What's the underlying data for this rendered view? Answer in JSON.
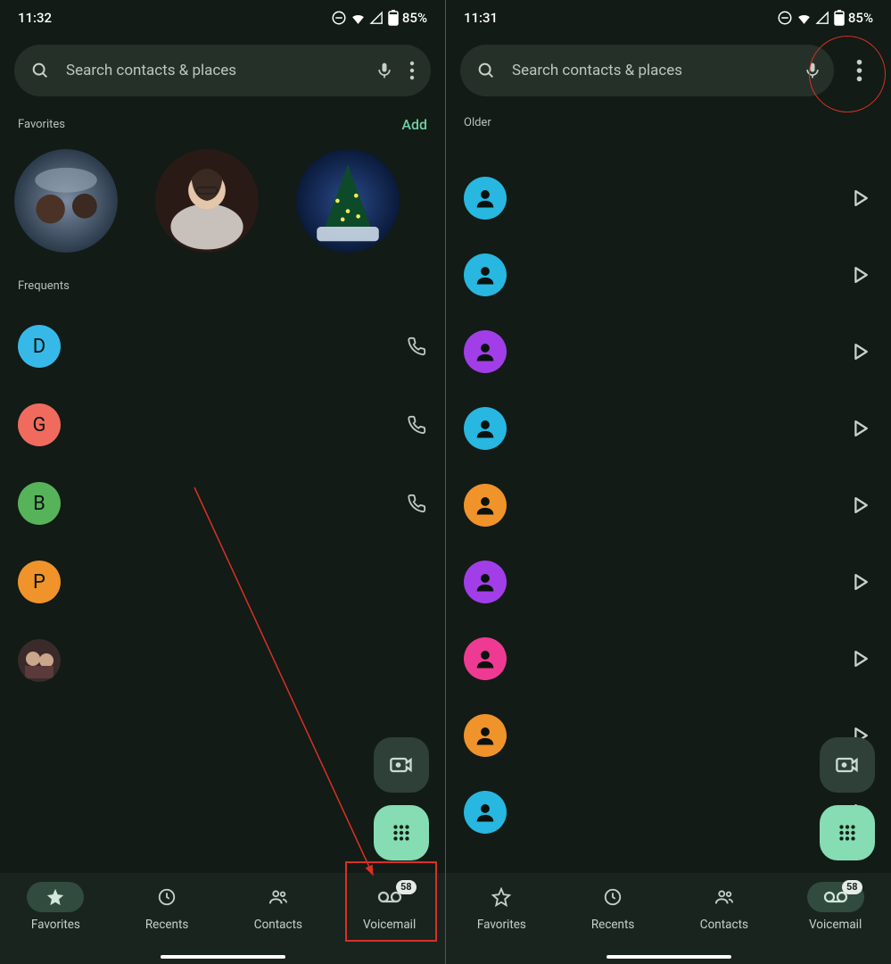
{
  "statusbar": {
    "left_time": "11:32",
    "right_time": "11:31",
    "battery": "85%"
  },
  "search": {
    "placeholder": "Search contacts & places"
  },
  "left": {
    "favorites_label": "Favorites",
    "add_label": "Add",
    "frequents_label": "Frequents",
    "frequents": [
      {
        "letter": "D",
        "color": "#36b9e8"
      },
      {
        "letter": "G",
        "color": "#f06b5e"
      },
      {
        "letter": "B",
        "color": "#56b35a"
      },
      {
        "letter": "P",
        "color": "#f0932a"
      }
    ]
  },
  "right": {
    "older_label": "Older",
    "voicemails": [
      {
        "color": "#28b7e0"
      },
      {
        "color": "#28b7e0"
      },
      {
        "color": "#a13ee8"
      },
      {
        "color": "#28b7e0"
      },
      {
        "color": "#f0932a"
      },
      {
        "color": "#a13ee8"
      },
      {
        "color": "#ef3a93"
      },
      {
        "color": "#f0932a"
      },
      {
        "color": "#28b7e0"
      }
    ]
  },
  "nav": {
    "favorites": "Favorites",
    "recents": "Recents",
    "contacts": "Contacts",
    "voicemail": "Voicemail",
    "vm_badge": "58"
  }
}
